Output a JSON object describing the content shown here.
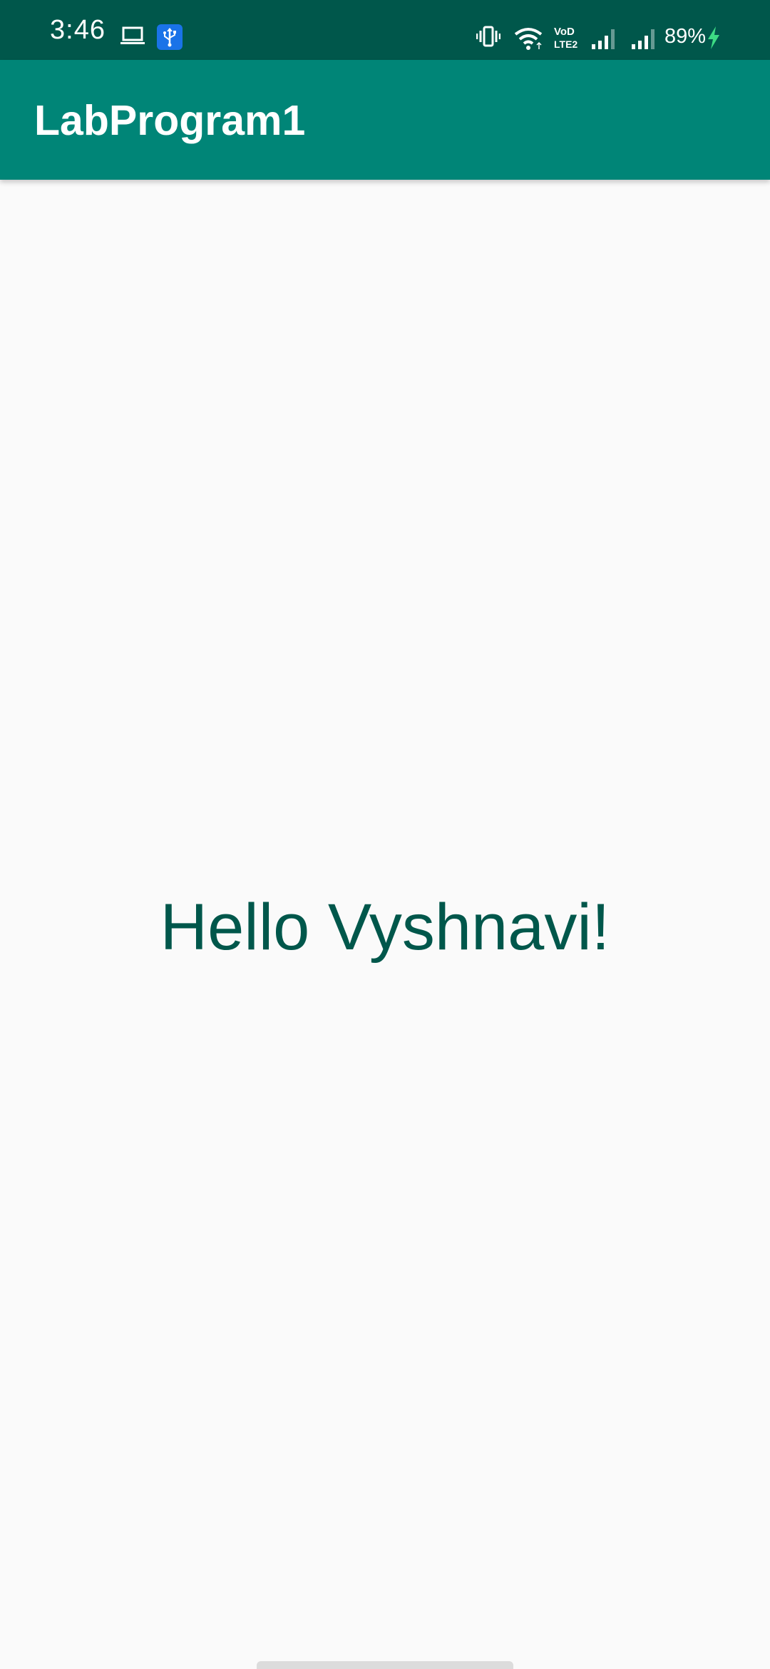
{
  "status_bar": {
    "time": "3:46",
    "battery_percent": "89%",
    "icons": [
      "laptop-icon",
      "usb-icon",
      "vibrate-icon",
      "wifi-icon",
      "volte-icon",
      "signal-icon",
      "signal-icon",
      "charging-icon"
    ],
    "volte_line1": "VoD",
    "volte_line2": "LTE2",
    "colors": {
      "background": "#00574b",
      "usb_badge": "#1a73e8",
      "charging": "#3ddc84"
    }
  },
  "app_bar": {
    "title": "LabProgram1",
    "color": "#008577"
  },
  "content": {
    "greeting": "Hello Vyshnavi!",
    "text_color": "#00574b"
  }
}
